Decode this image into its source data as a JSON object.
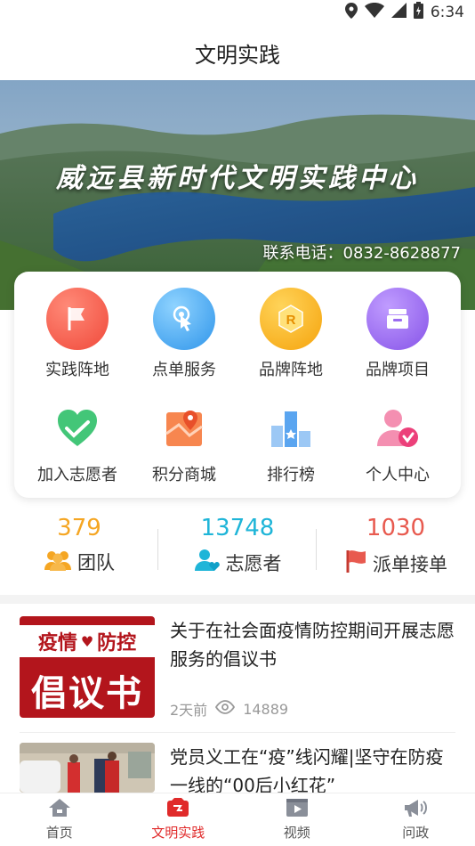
{
  "status_bar": {
    "time": "6:34",
    "icons": [
      "location-icon",
      "wifi-icon",
      "signal-icon",
      "battery-icon"
    ]
  },
  "header": {
    "title": "文明实践"
  },
  "banner": {
    "title": "威远县新时代文明实践中心",
    "phone": "联系电话：0832-8628877"
  },
  "menu": {
    "items": [
      {
        "label": "实践阵地",
        "icon": "flag-icon",
        "color": "#f25b4a"
      },
      {
        "label": "点单服务",
        "icon": "tap-icon",
        "color": "#3fa8f0"
      },
      {
        "label": "品牌阵地",
        "icon": "brand-r-icon",
        "color": "#f7a81b"
      },
      {
        "label": "品牌项目",
        "icon": "inbox-icon",
        "color": "#9b6cf0"
      },
      {
        "label": "加入志愿者",
        "icon": "heart-hand-icon",
        "color": "#3cbf6b"
      },
      {
        "label": "积分商城",
        "icon": "map-mall-icon",
        "color": "#f26c3a"
      },
      {
        "label": "排行榜",
        "icon": "ranking-icon",
        "color": "#5aa5f0"
      },
      {
        "label": "个人中心",
        "icon": "user-check-icon",
        "color": "#f06292"
      }
    ]
  },
  "stats": [
    {
      "value": "379",
      "label": "团队",
      "icon": "team-icon",
      "color": "#f5a623"
    },
    {
      "value": "13748",
      "label": "志愿者",
      "icon": "volunteer-icon",
      "color": "#1fb5d8"
    },
    {
      "value": "1030",
      "label": "派单接单",
      "icon": "red-flag-icon",
      "color": "#e85a4f"
    }
  ],
  "news": [
    {
      "title": "关于在社会面疫情防控期间开展志愿服务的倡议书",
      "thumb_text_top_left": "疫情",
      "thumb_text_top_right": "防控",
      "thumb_text_main": "倡议书",
      "time": "2天前",
      "views": "14889"
    },
    {
      "title": "党员义工在“疫”线闪耀|坚守在防疫一线的“00后小红花”"
    }
  ],
  "bottom_nav": [
    {
      "label": "首页",
      "icon": "home-icon",
      "active": false
    },
    {
      "label": "文明实践",
      "icon": "practice-icon",
      "active": true
    },
    {
      "label": "视频",
      "icon": "video-icon",
      "active": false
    },
    {
      "label": "问政",
      "icon": "megaphone-icon",
      "active": false
    }
  ]
}
